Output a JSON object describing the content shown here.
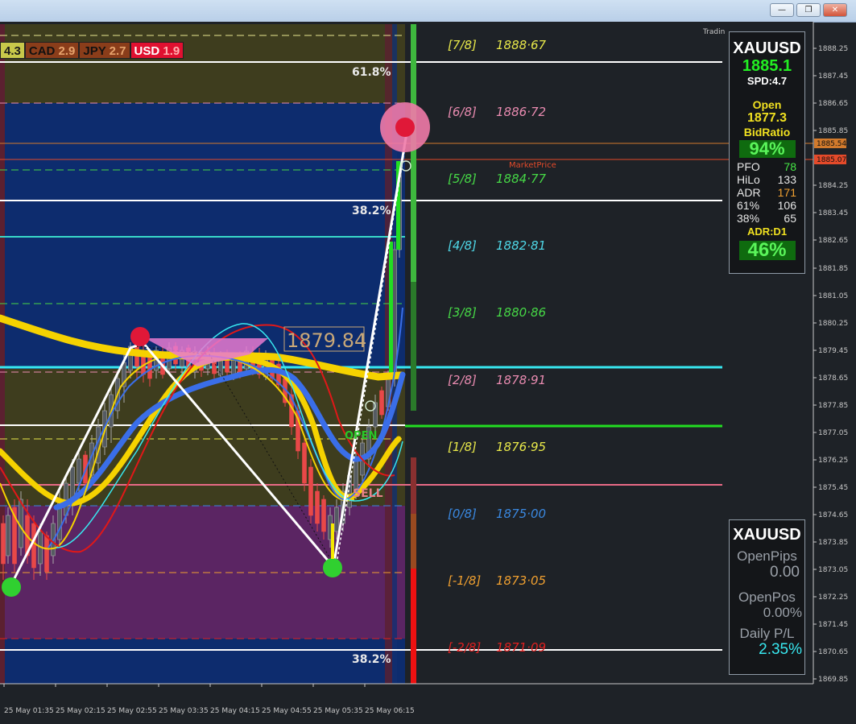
{
  "window": {
    "minimize_label": "—",
    "restore_label": "❐",
    "close_label": "✕"
  },
  "chart_header": {
    "label": "Tradin"
  },
  "currency_strength": [
    {
      "code": "",
      "value": "4.3",
      "bg": "#c8c84a",
      "color": "#1a1a1a",
      "code_color": "#1a1a1a"
    },
    {
      "code": "CAD",
      "value": "2.9",
      "bg": "#8a3d1a",
      "color": "#e7a36c",
      "code_color": "#111111"
    },
    {
      "code": "JPY",
      "value": "2.7",
      "bg": "#8a3d1a",
      "color": "#e7a36c",
      "code_color": "#111111"
    },
    {
      "code": "USD",
      "value": "1.9",
      "bg": "#e01030",
      "color": "#ffb0b0",
      "code_color": "#ffffff"
    }
  ],
  "price_axis": [
    "1888.25",
    "1887.45",
    "1886.65",
    "1885.85",
    "1884.25",
    "1883.45",
    "1882.65",
    "1881.85",
    "1881.05",
    "1880.25",
    "1879.45",
    "1878.65",
    "1877.85",
    "1877.05",
    "1876.25",
    "1875.45",
    "1874.65",
    "1873.85",
    "1873.05",
    "1872.25",
    "1871.45",
    "1870.65",
    "1869.85"
  ],
  "price_tags": {
    "tag1": "1885.54",
    "tag2": "1885.07"
  },
  "time_axis": [
    "25 May 01:35",
    "25 May 02:15",
    "25 May 02:55",
    "25 May 03:35",
    "25 May 04:15",
    "25 May 04:55",
    "25 May 05:35",
    "25 May 06:15"
  ],
  "murrey_levels": [
    {
      "label": "[7/8]",
      "value": "1888·67",
      "color": "#e8e84a"
    },
    {
      "label": "[6/8]",
      "value": "1886·72",
      "color": "#e98bb0"
    },
    {
      "label": "[5/8]",
      "value": "1884·77",
      "color": "#46d846"
    },
    {
      "label": "[4/8]",
      "value": "1882·81",
      "color": "#4fd8e8"
    },
    {
      "label": "[3/8]",
      "value": "1880·86",
      "color": "#46d846"
    },
    {
      "label": "[2/8]",
      "value": "1878·91",
      "color": "#e98bb0"
    },
    {
      "label": "[1/8]",
      "value": "1876·95",
      "color": "#e8e84a"
    },
    {
      "label": "[0/8]",
      "value": "1875·00",
      "color": "#3a88e0"
    },
    {
      "label": "[-1/8]",
      "value": "1873·05",
      "color": "#f0a030"
    },
    {
      "label": "[-2/8]",
      "value": "1871·09",
      "color": "#e02020"
    }
  ],
  "fib_labels": {
    "top": "61.8%",
    "mid": "38.2%",
    "bottom": "38.2%"
  },
  "annotations": {
    "market_price": "MarketPrice",
    "price_box": "1879.84",
    "open_label": "OPEN",
    "sell_label": "SELL"
  },
  "info_panel": {
    "symbol": "XAUUSD",
    "bid": "1885.1",
    "spread": "SPD:4.7",
    "open_label": "Open",
    "open_value": "1877.3",
    "bid_ratio_label": "BidRatio",
    "bid_ratio": "94%",
    "stats": [
      {
        "name": "PFO",
        "value": "78",
        "color": "#46e846"
      },
      {
        "name": "HiLo",
        "value": "133",
        "color": "#e6e6e6"
      },
      {
        "name": "ADR",
        "value": "171",
        "color": "#f0a030"
      },
      {
        "name": "61%",
        "value": "106",
        "color": "#e6e6e6"
      },
      {
        "name": "38%",
        "value": "65",
        "color": "#e6e6e6"
      }
    ],
    "adr_label": "ADR:D1",
    "adr_pct": "46%"
  },
  "pl_panel": {
    "symbol": "XAUUSD",
    "open_pips_label": "OpenPips",
    "open_pips": "0.00",
    "open_pos_label": "OpenPos",
    "open_pos": "0.00%",
    "daily_pl_label": "Daily P/L",
    "daily_pl": "2.35%"
  }
}
